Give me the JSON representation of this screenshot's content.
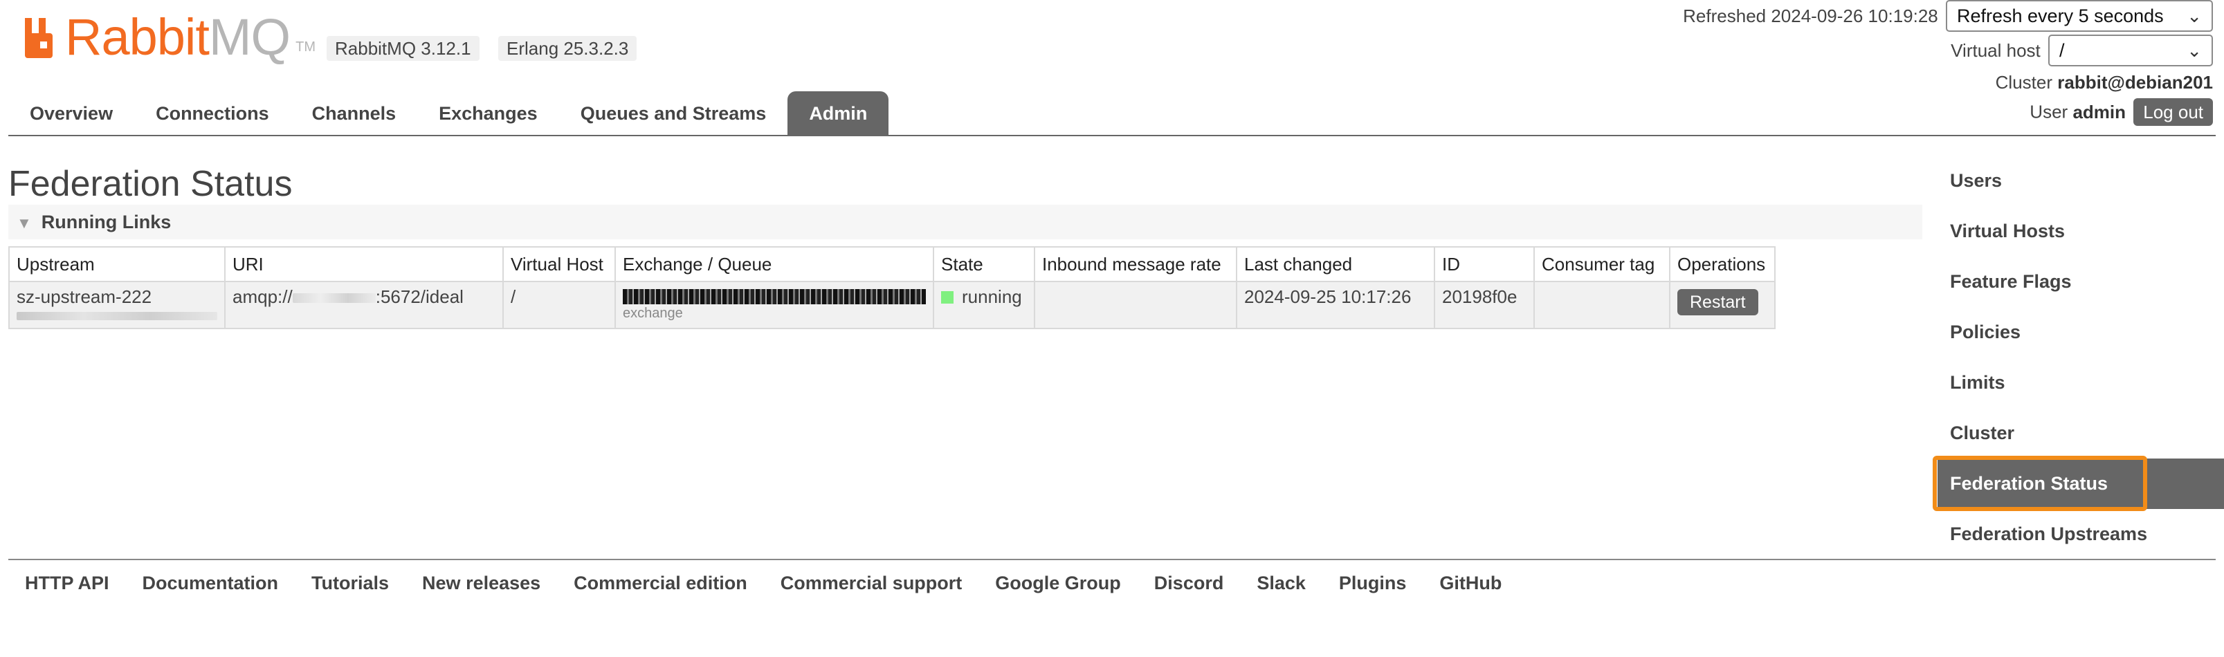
{
  "header": {
    "logo_rabbit": "Rabbit",
    "logo_mq": "MQ",
    "logo_tm": "TM",
    "rabbitmq_version": "RabbitMQ 3.12.1",
    "erlang_version": "Erlang 25.3.2.3",
    "refreshed_label": "Refreshed 2024-09-26 10:19:28",
    "refresh_select": "Refresh every 5 seconds",
    "virtual_host_label": "Virtual host",
    "virtual_host_value": "/",
    "cluster_label": "Cluster",
    "cluster_name": "rabbit@debian201",
    "user_label": "User",
    "user_name": "admin",
    "logout_label": "Log out"
  },
  "tabs": [
    {
      "label": "Overview",
      "active": false
    },
    {
      "label": "Connections",
      "active": false
    },
    {
      "label": "Channels",
      "active": false
    },
    {
      "label": "Exchanges",
      "active": false
    },
    {
      "label": "Queues and Streams",
      "active": false
    },
    {
      "label": "Admin",
      "active": true
    }
  ],
  "main": {
    "title": "Federation Status",
    "section_title": "Running Links",
    "table": {
      "headers": [
        "Upstream",
        "URI",
        "Virtual Host",
        "Exchange / Queue",
        "State",
        "Inbound message rate",
        "Last changed",
        "ID",
        "Consumer tag",
        "Operations"
      ],
      "rows": [
        {
          "upstream": "sz-upstream-222",
          "uri_prefix": "amqp://",
          "uri_suffix": ":5672/ideal",
          "vhost": "/",
          "type": "exchange",
          "state": "running",
          "inbound_rate": "",
          "last_changed": "2024-09-25 10:17:26",
          "id": "20198f0e",
          "consumer_tag": "",
          "operation_label": "Restart"
        }
      ]
    }
  },
  "sidebar": {
    "items": [
      {
        "label": "Users",
        "active": false
      },
      {
        "label": "Virtual Hosts",
        "active": false
      },
      {
        "label": "Feature Flags",
        "active": false
      },
      {
        "label": "Policies",
        "active": false
      },
      {
        "label": "Limits",
        "active": false
      },
      {
        "label": "Cluster",
        "active": false
      },
      {
        "label": "Federation Status",
        "active": true
      },
      {
        "label": "Federation Upstreams",
        "active": false
      }
    ]
  },
  "footer": {
    "links": [
      "HTTP API",
      "Documentation",
      "Tutorials",
      "New releases",
      "Commercial edition",
      "Commercial support",
      "Google Group",
      "Discord",
      "Slack",
      "Plugins",
      "GitHub"
    ]
  },
  "colors": {
    "brand_orange": "#f26b21",
    "tab_active": "#666666",
    "highlight": "#f28c18",
    "running": "#80f080"
  }
}
